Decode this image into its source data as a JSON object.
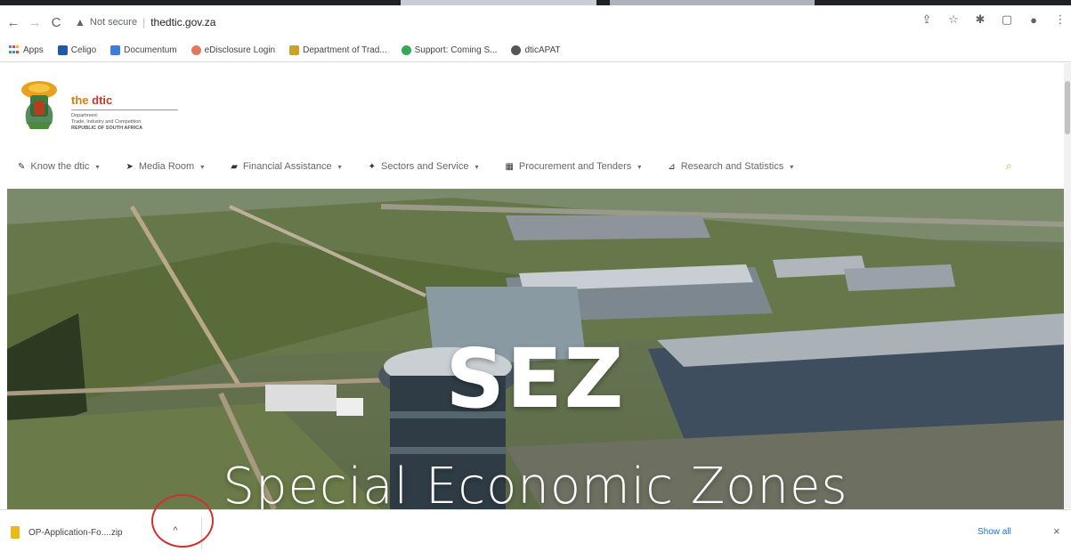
{
  "browser": {
    "security_label": "Not secure",
    "separator": "|",
    "url": "thedtic.gov.za",
    "icons": [
      "back-icon",
      "forward-icon",
      "reload-icon",
      "warning-icon",
      "share-icon",
      "star-icon",
      "extensions-icon",
      "sidepanel-icon",
      "profile-icon",
      "menu-icon"
    ]
  },
  "bookmarks": [
    {
      "label": "Apps",
      "icon": "apps-icon",
      "color": "#4285f4"
    },
    {
      "label": "Celigo",
      "icon": "celigo-icon",
      "color": "#1e5aa8"
    },
    {
      "label": "Documentum",
      "icon": "documentum-icon",
      "color": "#3b7dd8"
    },
    {
      "label": "eDisclosure Login",
      "icon": "edisclosure-icon",
      "color": "#e07a5f"
    },
    {
      "label": "Department of Trad...",
      "icon": "dtic-icon",
      "color": "#c9a227"
    },
    {
      "label": "Support: Coming S...",
      "icon": "support-icon",
      "color": "#34a853"
    },
    {
      "label": "dticAPAT",
      "icon": "globe-icon",
      "color": "#555555"
    }
  ],
  "site": {
    "brand_prefix": "the ",
    "brand_name": "dtic",
    "brand_sub_1": "Department:",
    "brand_sub_2": "Trade, Industry and Competition",
    "brand_sub_3": "REPUBLIC OF SOUTH AFRICA",
    "nav": [
      {
        "label": "Know the dtic",
        "icon": "pin-icon"
      },
      {
        "label": "Media Room",
        "icon": "megaphone-icon"
      },
      {
        "label": "Financial Assistance",
        "icon": "money-icon"
      },
      {
        "label": "Sectors and Service",
        "icon": "sector-icon"
      },
      {
        "label": "Procurement and Tenders",
        "icon": "tender-icon"
      },
      {
        "label": "Research and Statistics",
        "icon": "stats-icon"
      }
    ],
    "hero_title": "SEZ",
    "hero_subtitle": "Special Economic Zones"
  },
  "downloads": {
    "file": "OP-Application-Fo....zip",
    "caret": "^",
    "show_all": "Show all",
    "close": "×"
  },
  "colors": {
    "accent_orange": "#e07a10",
    "annotation_red": "#d32f2f",
    "link_blue": "#1a73e8"
  }
}
